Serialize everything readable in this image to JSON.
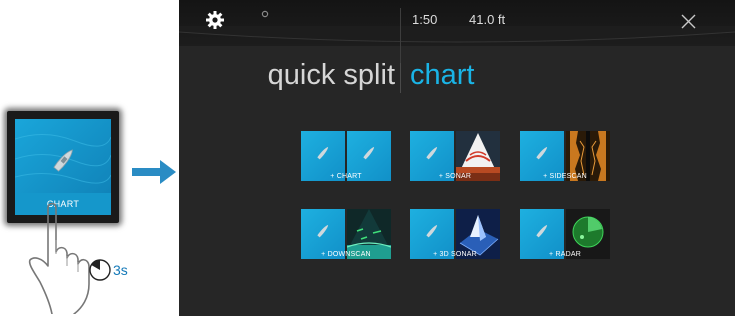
{
  "illustration": {
    "tile_label": "CHART",
    "hold_duration": "3s"
  },
  "statusbar": {
    "time": "1:50",
    "depth": "41.0 ft"
  },
  "title": {
    "left": "quick split",
    "right": "chart"
  },
  "options": [
    {
      "label": "+ CHART",
      "panel": "chart"
    },
    {
      "label": "+ SONAR",
      "panel": "sonar"
    },
    {
      "label": "+ SIDESCAN",
      "panel": "sidescan"
    },
    {
      "label": "+ DOWNSCAN",
      "panel": "downscan"
    },
    {
      "label": "+ 3D SONAR",
      "panel": "3d-sonar"
    },
    {
      "label": "+ RADAR",
      "panel": "radar"
    }
  ],
  "colors": {
    "accent": "#1ab4e6",
    "screen_bg": "#262626",
    "chart_tile": "#1597cb",
    "arrow": "#2a8cc4"
  },
  "icons": [
    "gear-icon",
    "close-icon",
    "boat-icon",
    "hand-icon",
    "timer-icon",
    "arrow-right-icon"
  ]
}
